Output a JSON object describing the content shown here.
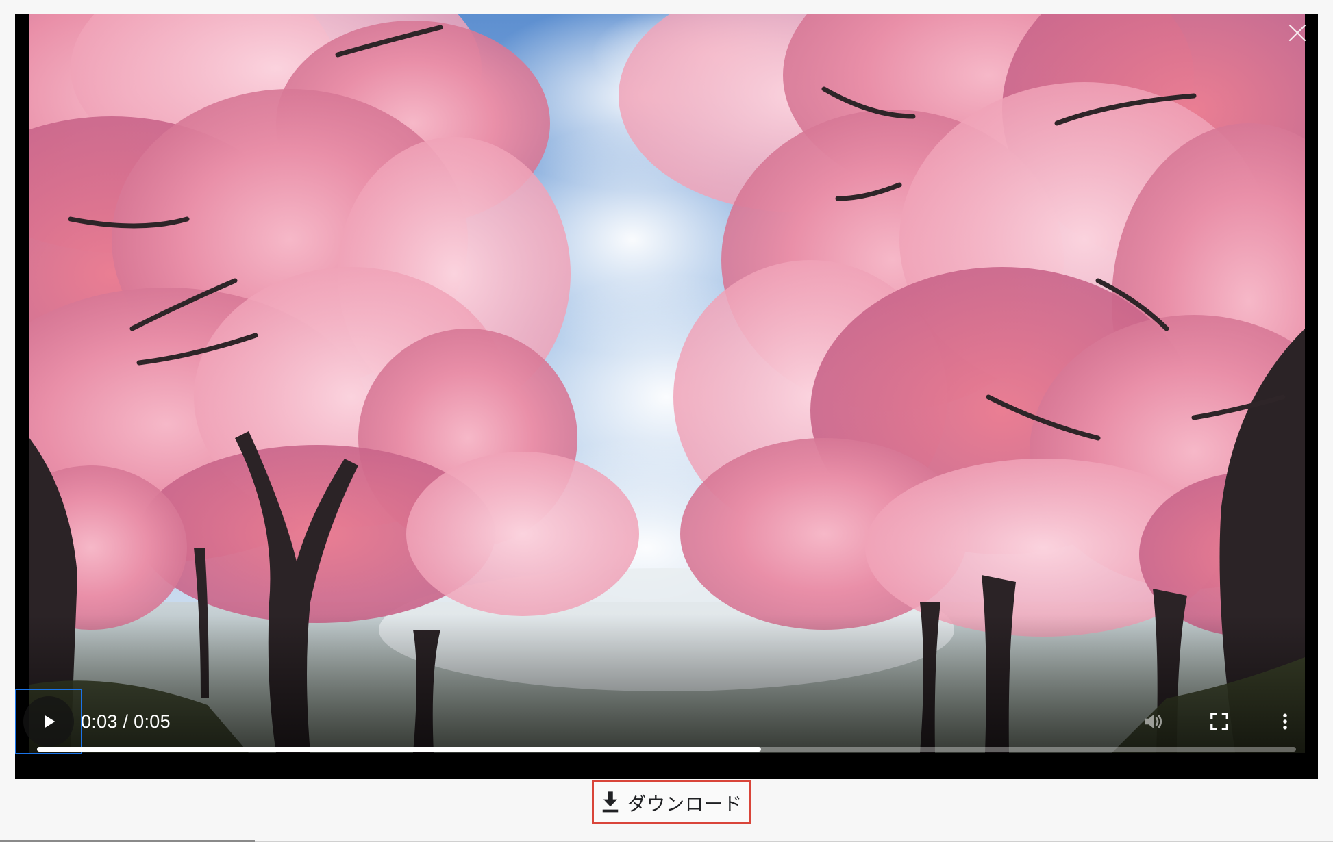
{
  "player": {
    "current_time": "0:03",
    "duration": "0:05",
    "time_separator": " / ",
    "progress_fraction": 0.575,
    "icons": {
      "play": "play-icon",
      "close": "close-icon",
      "mute": "volume-icon",
      "fullscreen": "fullscreen-icon",
      "more": "more-vert-icon"
    },
    "colors": {
      "focus_ring": "#1a73e8",
      "progress_fill": "#ffffff"
    }
  },
  "download": {
    "label": "ダウンロード",
    "icon": "download-icon",
    "highlight_color": "#d9453a"
  }
}
